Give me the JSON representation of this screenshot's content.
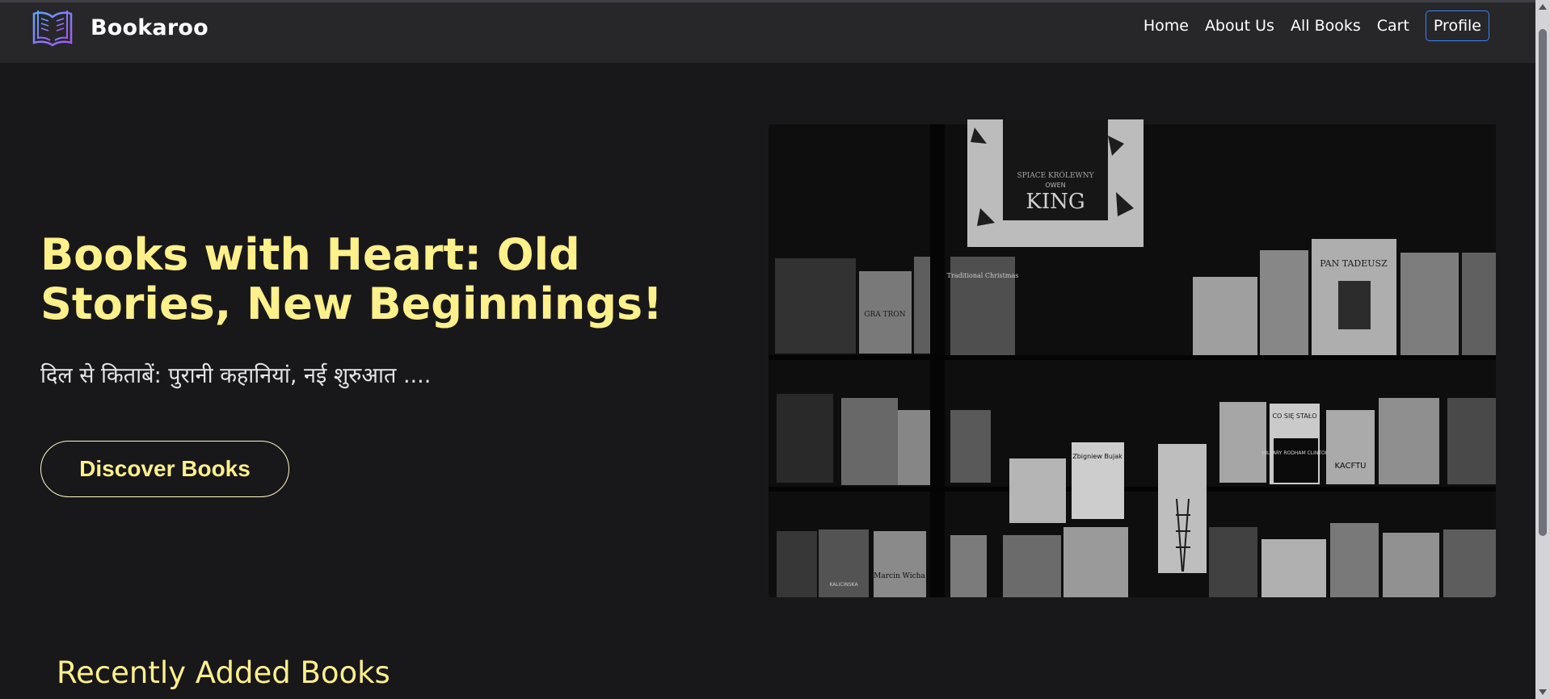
{
  "brand": {
    "name": "Bookaroo",
    "logo_icon": "open-book-icon"
  },
  "nav": {
    "links": [
      "Home",
      "About Us",
      "All Books",
      "Cart"
    ],
    "profile_label": "Profile"
  },
  "hero": {
    "title": "Books with Heart: Old Stories, New Beginnings!",
    "subtitle": "दिल से किताबें: पुरानी कहानियां, नई शुरुआत ....",
    "cta_label": "Discover Books",
    "image_texts": {
      "poster_top": "SPIACE KRÓLEWNY",
      "poster_author": "OWEN",
      "poster_author_last": "KING",
      "book_a": "PAN TADEUSZ",
      "book_b": "HILLARY RODHAM CLINTON",
      "book_c": "KACFTU",
      "book_d": "Zbigniew Bujak",
      "book_e": "Traditional Christmas",
      "book_f": "KALICINSKA",
      "book_g": "Marcin Wicha",
      "book_h": "CO SIĘ STAŁO"
    }
  },
  "recent": {
    "title": "Recently Added Books"
  },
  "colors": {
    "background": "#18181b",
    "navbar": "#27272a",
    "accent_yellow": "#fef08a",
    "profile_border": "#3b82f6"
  }
}
